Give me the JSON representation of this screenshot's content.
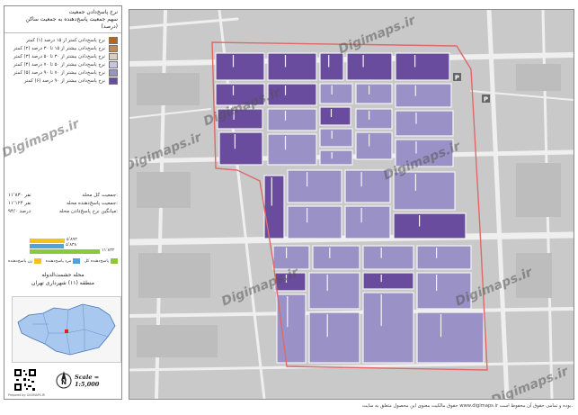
{
  "legend": {
    "title_line1": "نرخ پاسخ‌دادن جمعیت",
    "title_line2": "سهم جمعیت پاسخ‌دهنده به جمعیت ساکن (درصد)",
    "items": [
      {
        "label": "نرخ پاسخ‌دادن کمتر از ۱۵ درصد (۱) کمتر",
        "color": "#b5651d"
      },
      {
        "label": "نرخ پاسخ‌دادن بیشتر از ۱۵ تا ۳۰ درصد (۲) کمتر",
        "color": "#c48a52"
      },
      {
        "label": "نرخ پاسخ‌دادن بیشتر از ۳۰ تا ۵۰ درصد (۳) کمتر",
        "color": "#d9cfc0"
      },
      {
        "label": "نرخ پاسخ‌دادن بیشتر از ۵۰ تا ۷۰ درصد (۴) کمتر",
        "color": "#c8c4e0"
      },
      {
        "label": "نرخ پاسخ‌دادن بیشتر از ۷۰ تا ۹۰ درصد (۵) کمتر",
        "color": "#9a92c6"
      },
      {
        "label": "نرخ پاسخ‌دادن بیشتر از ۹۰ درصد (۶) کمتر",
        "color": "#6a4c9e"
      }
    ]
  },
  "stats": {
    "rows": [
      {
        "label": "جمعیت کل محله:",
        "value": "۱۱٬۸۳۰ نفر"
      },
      {
        "label": "جمعیت پاسخ‌دهنده محله:",
        "value": "۱۱٬۱۲۴ نفر"
      },
      {
        "label": "میانگین نرخ پاسخ‌دادن محله:",
        "value": "۹۴/۰ درصد"
      }
    ]
  },
  "bars": [
    {
      "value": "۵٬۸۹۳",
      "color": "#f0c419",
      "fraction": 0.5
    },
    {
      "value": "۵٬۸۳۸",
      "color": "#4fa3d8",
      "fraction": 0.49
    },
    {
      "value": "۱۱٬۸۳۲",
      "color": "#8dc63f",
      "fraction": 1.0
    }
  ],
  "keys": [
    {
      "label": "زن پاسخ‌دهنده",
      "color": "#f0c419"
    },
    {
      "label": "مرد پاسخ‌دهنده",
      "color": "#4fa3d8"
    },
    {
      "label": "پاسخ‌دهنده کل",
      "color": "#8dc63f"
    }
  ],
  "location": {
    "line1": "محله حشمت‌الدوله",
    "line2": "منطقه (۱۱) شهرداری تهران"
  },
  "scale": "Scale = 1:5,000",
  "credit": "Prepared by: DIGIMAPS.IR",
  "footer": "حقوق مالکیت معنوی این محصول متعلق به سایت www.digimaps.ir بوده و تمامی حقوق آن محفوظ است.",
  "watermark": "Digimaps.ir",
  "colors": {
    "boundary": "#e06868",
    "road": "#f2f2f2",
    "background": "#c9c9c9",
    "dark_purple": "#6a4c9e",
    "mid_purple": "#9a92c6",
    "light_purple": "#b9b4dc"
  }
}
